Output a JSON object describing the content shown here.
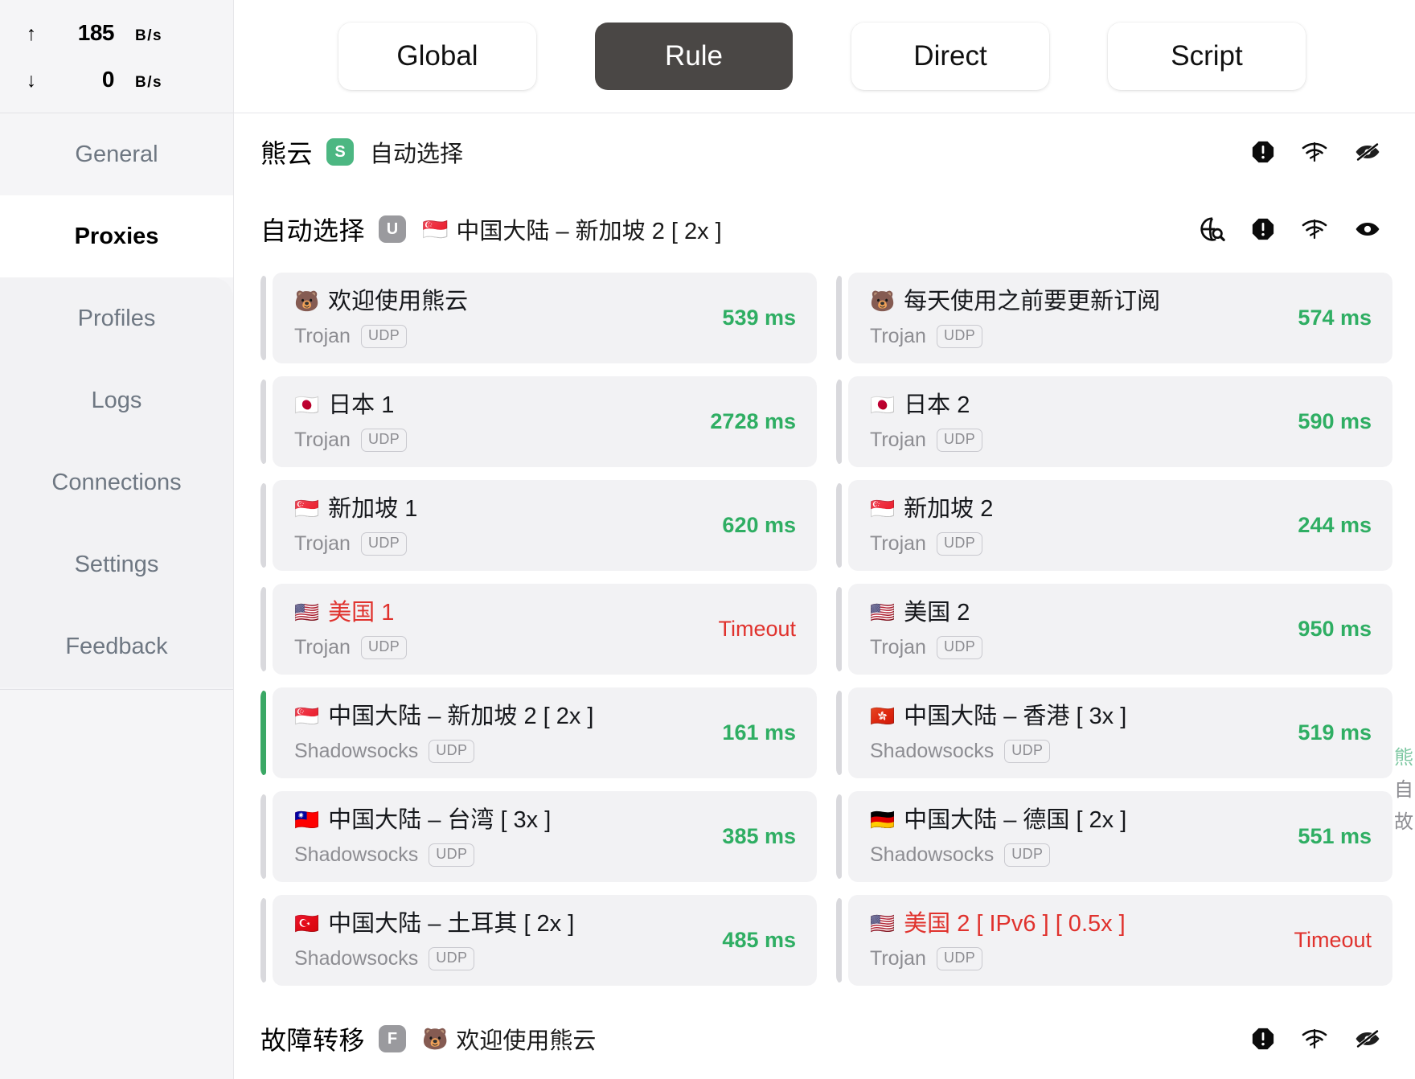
{
  "sidebar": {
    "speed": {
      "up_arrow": "↑",
      "up_value": "185",
      "up_unit": "B/s",
      "down_arrow": "↓",
      "down_value": "0",
      "down_unit": "B/s"
    },
    "items": [
      {
        "label": "General",
        "active": false
      },
      {
        "label": "Proxies",
        "active": true
      },
      {
        "label": "Profiles",
        "active": false
      },
      {
        "label": "Logs",
        "active": false
      },
      {
        "label": "Connections",
        "active": false
      },
      {
        "label": "Settings",
        "active": false
      },
      {
        "label": "Feedback",
        "active": false
      }
    ]
  },
  "topbar": {
    "tabs": [
      {
        "label": "Global",
        "active": false
      },
      {
        "label": "Rule",
        "active": true
      },
      {
        "label": "Direct",
        "active": false
      },
      {
        "label": "Script",
        "active": false
      }
    ]
  },
  "groups": [
    {
      "title": "熊云",
      "badge": "S",
      "badge_kind": "s",
      "sub_flag": "",
      "sub": "自动选择",
      "icons": [
        "alert-octagon-icon",
        "speed-test-icon",
        "eye-off-icon"
      ]
    },
    {
      "title": "自动选择",
      "badge": "U",
      "badge_kind": "u",
      "sub_flag": "🇸🇬",
      "sub": "中国大陆 – 新加坡 2 [ 2x ]",
      "icons": [
        "globe-search-icon",
        "alert-octagon-icon",
        "speed-test-icon",
        "eye-icon"
      ]
    },
    {
      "title": "故障转移",
      "badge": "F",
      "badge_kind": "f",
      "sub_flag": "🐻",
      "sub": "欢迎使用熊云",
      "icons": [
        "alert-octagon-icon",
        "speed-test-icon",
        "eye-off-icon"
      ]
    }
  ],
  "proxies": [
    {
      "flag": "🐻",
      "name": "欢迎使用熊云",
      "proto": "Trojan",
      "udp": "UDP",
      "latency": "539 ms",
      "state": "ok",
      "selected": false
    },
    {
      "flag": "🐻",
      "name": "每天使用之前要更新订阅",
      "proto": "Trojan",
      "udp": "UDP",
      "latency": "574 ms",
      "state": "ok",
      "selected": false
    },
    {
      "flag": "🇯🇵",
      "name": "日本 1",
      "proto": "Trojan",
      "udp": "UDP",
      "latency": "2728 ms",
      "state": "ok",
      "selected": false
    },
    {
      "flag": "🇯🇵",
      "name": "日本 2",
      "proto": "Trojan",
      "udp": "UDP",
      "latency": "590 ms",
      "state": "ok",
      "selected": false
    },
    {
      "flag": "🇸🇬",
      "name": "新加坡 1",
      "proto": "Trojan",
      "udp": "UDP",
      "latency": "620 ms",
      "state": "ok",
      "selected": false
    },
    {
      "flag": "🇸🇬",
      "name": "新加坡 2",
      "proto": "Trojan",
      "udp": "UDP",
      "latency": "244 ms",
      "state": "ok",
      "selected": false
    },
    {
      "flag": "🇺🇸",
      "name": "美国 1",
      "proto": "Trojan",
      "udp": "UDP",
      "latency": "Timeout",
      "state": "timeout",
      "selected": false
    },
    {
      "flag": "🇺🇸",
      "name": "美国 2",
      "proto": "Trojan",
      "udp": "UDP",
      "latency": "950 ms",
      "state": "ok",
      "selected": false
    },
    {
      "flag": "🇸🇬",
      "name": "中国大陆 – 新加坡 2 [ 2x ]",
      "proto": "Shadowsocks",
      "udp": "UDP",
      "latency": "161 ms",
      "state": "ok",
      "selected": true
    },
    {
      "flag": "🇭🇰",
      "name": "中国大陆 – 香港 [ 3x ]",
      "proto": "Shadowsocks",
      "udp": "UDP",
      "latency": "519 ms",
      "state": "ok",
      "selected": false
    },
    {
      "flag": "🇹🇼",
      "name": "中国大陆 – 台湾 [ 3x ]",
      "proto": "Shadowsocks",
      "udp": "UDP",
      "latency": "385 ms",
      "state": "ok",
      "selected": false
    },
    {
      "flag": "🇩🇪",
      "name": "中国大陆 – 德国 [ 2x ]",
      "proto": "Shadowsocks",
      "udp": "UDP",
      "latency": "551 ms",
      "state": "ok",
      "selected": false
    },
    {
      "flag": "🇹🇷",
      "name": "中国大陆 – 土耳其 [ 2x ]",
      "proto": "Shadowsocks",
      "udp": "UDP",
      "latency": "485 ms",
      "state": "ok",
      "selected": false
    },
    {
      "flag": "🇺🇸",
      "name": "美国 2 [ IPv6 ] [ 0.5x ]",
      "proto": "Trojan",
      "udp": "UDP",
      "latency": "Timeout",
      "state": "timeout",
      "selected": false
    }
  ],
  "rail": [
    {
      "label": "熊",
      "active": true
    },
    {
      "label": "自",
      "active": false
    },
    {
      "label": "故",
      "active": false
    }
  ],
  "colors": {
    "accent_green": "#3aa865",
    "latency_green": "#2fae63",
    "timeout_red": "#e0322d",
    "tab_active_bg": "#4a4745",
    "card_bg": "#f2f2f4",
    "sidebar_bg": "#f5f5f7"
  }
}
